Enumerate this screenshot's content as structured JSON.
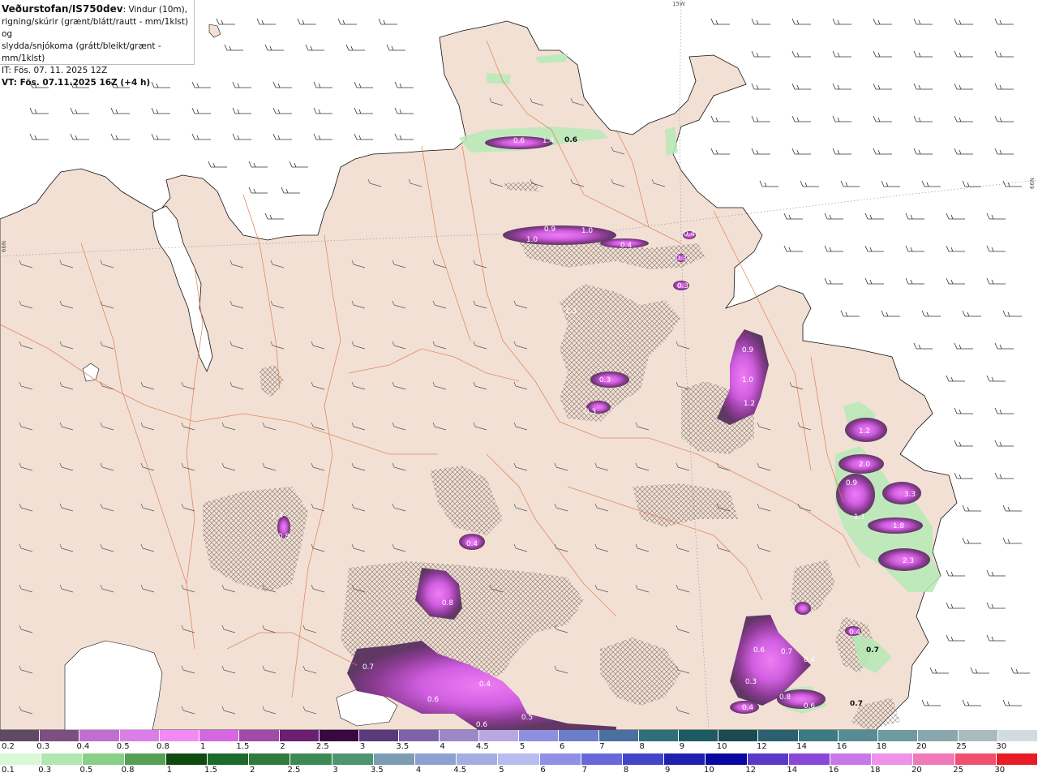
{
  "header": {
    "model": "Veðurstofan/IS750dev",
    "desc_1": ": Vindur (10m),",
    "desc_2": "rigning/skúrir (grænt/blátt/rautt - mm/1klst) og",
    "desc_3": "slydda/snjókoma (grátt/bleikt/grænt - mm/1klst)",
    "it": "IT: Fös. 07. 11. 2025 12Z",
    "vt": "VT: Fös. 07.11.2025 16Z (+4 h)"
  },
  "graticule": {
    "lon_label": "15W",
    "lat_label_left": "66N",
    "lat_label_right": "66N"
  },
  "precip_values": [
    "0.6",
    "1.4",
    "0.6",
    "0.9",
    "1.0",
    "1.0",
    "0.4",
    "0.4",
    "0.3",
    "0.3",
    "1.3",
    "0.3",
    "0.3",
    "0.9",
    "1.0",
    "1.2",
    "1.2",
    "2.0",
    "0.9",
    "1.1",
    "3.3",
    "1.8",
    "2.3",
    "0.4",
    "0.4",
    "0.8",
    "0.8",
    "0.4",
    "0.6",
    "0.7",
    "0.4",
    "0.3",
    "0.8",
    "0.6",
    "0.4",
    "0.7",
    "0.6",
    "0.5",
    "0.6",
    "0.7",
    "0.7",
    "1.3"
  ],
  "legend_snow": {
    "labels": [
      "0.2",
      "0.3",
      "0.4",
      "0.5",
      "0.8",
      "1",
      "1.5",
      "2",
      "2.5",
      "3",
      "3.5",
      "4",
      "4.5",
      "5",
      "6",
      "7",
      "8",
      "9",
      "10",
      "12",
      "14",
      "16",
      "18",
      "20",
      "25",
      "30"
    ],
    "colors": [
      "#5e4a63",
      "#7b4f7f",
      "#c06fd0",
      "#da7fe8",
      "#f28af5",
      "#d567e0",
      "#a04aaa",
      "#6a1f70",
      "#3a0840",
      "#5a3a7a",
      "#7e62a8",
      "#9c88c8",
      "#b8a8e0",
      "#8f8fe0",
      "#6b7fc8",
      "#4b6f9e",
      "#2f6f7a",
      "#1e5a62",
      "#1a4a52",
      "#2a6070",
      "#3e7a84",
      "#588c94",
      "#6e9aa0",
      "#8aa8ac",
      "#a8bcc0",
      "#d2dcde"
    ]
  },
  "legend_rain": {
    "labels": [
      "0.1",
      "0.3",
      "0.5",
      "0.8",
      "1",
      "1.5",
      "2",
      "2.5",
      "3",
      "3.5",
      "4",
      "4.5",
      "5",
      "6",
      "7",
      "8",
      "9",
      "10",
      "12",
      "14",
      "16",
      "18",
      "20",
      "25",
      "30"
    ],
    "colors": [
      "#d8f8d8",
      "#b0e8b0",
      "#88d088",
      "#55a055",
      "#0f4a0f",
      "#1e6a2a",
      "#2f7a3c",
      "#3e8a56",
      "#4e9470",
      "#7c9cb4",
      "#8ea2d0",
      "#a4aee2",
      "#b8bcee",
      "#9090e6",
      "#6868d8",
      "#4444c8",
      "#2020b0",
      "#0808a0",
      "#5a3ac8",
      "#8a48d8",
      "#c878e8",
      "#ee92ea",
      "#f07ab8",
      "#f05070",
      "#e81c24"
    ]
  }
}
